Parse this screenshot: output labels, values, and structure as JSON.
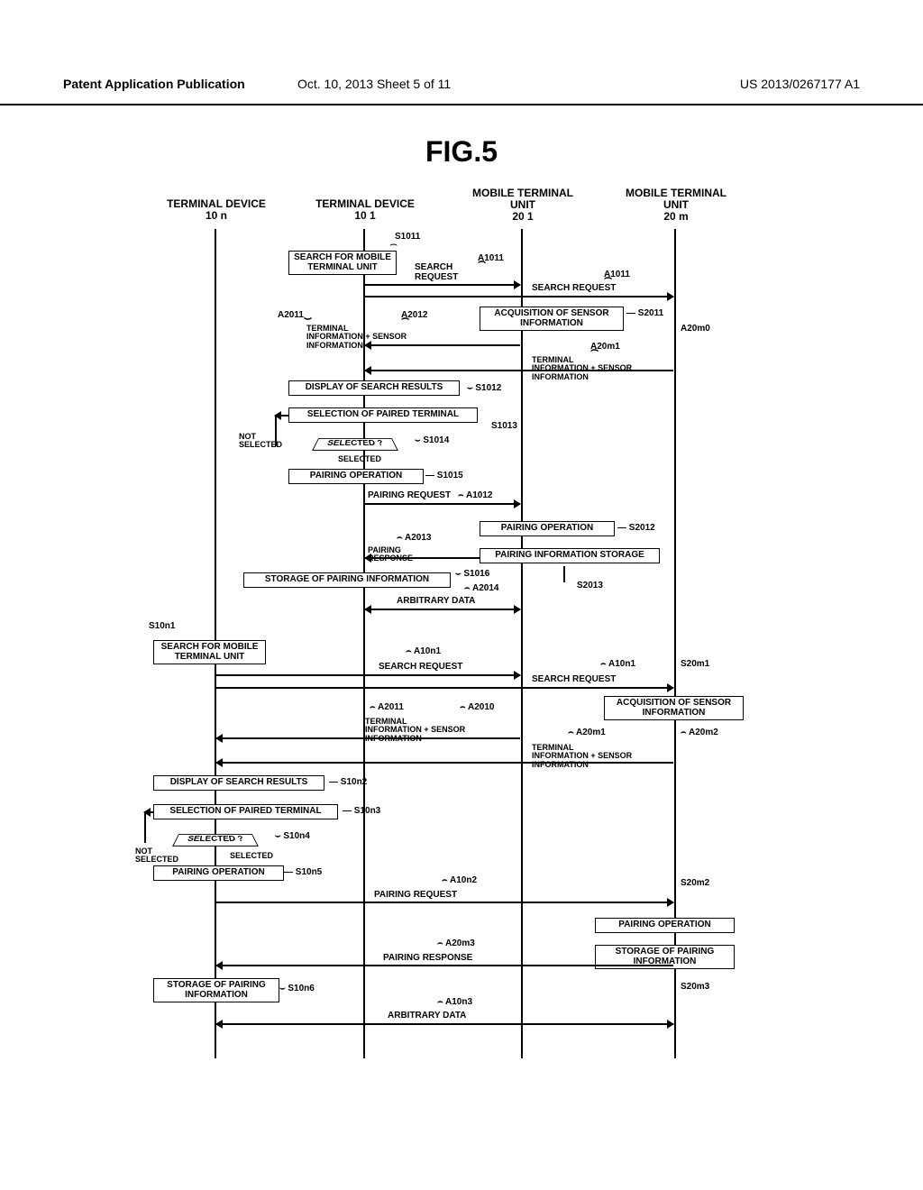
{
  "header": {
    "left": "Patent Application Publication",
    "mid": "Oct. 10, 2013  Sheet 5 of 11",
    "right": "US 2013/0267177 A1"
  },
  "fig_title": "FIG.5",
  "columns": {
    "c1": {
      "label": "TERMINAL DEVICE",
      "sub": "10 n"
    },
    "c2": {
      "label": "TERMINAL DEVICE",
      "sub": "10 1"
    },
    "c3": {
      "label": "MOBILE TERMINAL UNIT",
      "sub": "20 1"
    },
    "c4": {
      "label": "MOBILE TERMINAL UNIT",
      "sub": "20 m"
    }
  },
  "steps": {
    "s1011": "S1011",
    "s1012": "S1012",
    "s1013": "S1013",
    "s1014": "S1014",
    "s1015": "S1015",
    "s1016": "S1016",
    "s2011": "S2011",
    "s2012": "S2012",
    "s2013": "S2013",
    "s10n1": "S10n1",
    "s10n2": "S10n2",
    "s10n3": "S10n3",
    "s10n4": "S10n4",
    "s10n5": "S10n5",
    "s10n6": "S10n6",
    "s20m1": "S20m1",
    "s20m2": "S20m2",
    "s20m3": "S20m3"
  },
  "msgs": {
    "a1011a": "A1011",
    "a1011b": "A1011",
    "a2011": "A2011",
    "a2012": "A2012",
    "a2013": "A2013",
    "a2014": "A2014",
    "a20m0": "A20m0",
    "a20m1": "A20m1",
    "a20m1b": "A20m1",
    "a20m2": "A20m2",
    "a20m3": "A20m3",
    "a1012": "A1012",
    "a10n1a": "A10n1",
    "a10n1b": "A10n1",
    "a10n2": "A10n2",
    "a10n3": "A10n3",
    "a2010": "A2010",
    "a2011b": "A2011"
  },
  "boxes": {
    "search_mobile": "SEARCH FOR MOBILE TERMINAL UNIT",
    "search_request": "SEARCH REQUEST",
    "search_request2": "SEARCH REQUEST",
    "acq_sensor": "ACQUISITION OF SENSOR INFORMATION",
    "term_sensor": "TERMINAL INFORMATION + SENSOR INFORMATION",
    "display_results": "DISPLAY OF SEARCH RESULTS",
    "select_paired": "SELECTION OF PAIRED TERMINAL",
    "selected_q": "SELECTED ?",
    "not_selected": "NOT SELECTED",
    "selected": "SELECTED",
    "pairing_op": "PAIRING OPERATION",
    "pairing_req": "PAIRING REQUEST",
    "pairing_resp": "PAIRING RESPONSE",
    "pairing_info_store": "PAIRING INFORMATION STORAGE",
    "store_pairing": "STORAGE OF PAIRING INFORMATION",
    "arb_data": "ARBITRARY DATA",
    "acq_sensor2": "ACQUISITION OF SENSOR INFORMATION",
    "store_pairing2": "STORAGE OF PAIRING INFORMATION"
  }
}
